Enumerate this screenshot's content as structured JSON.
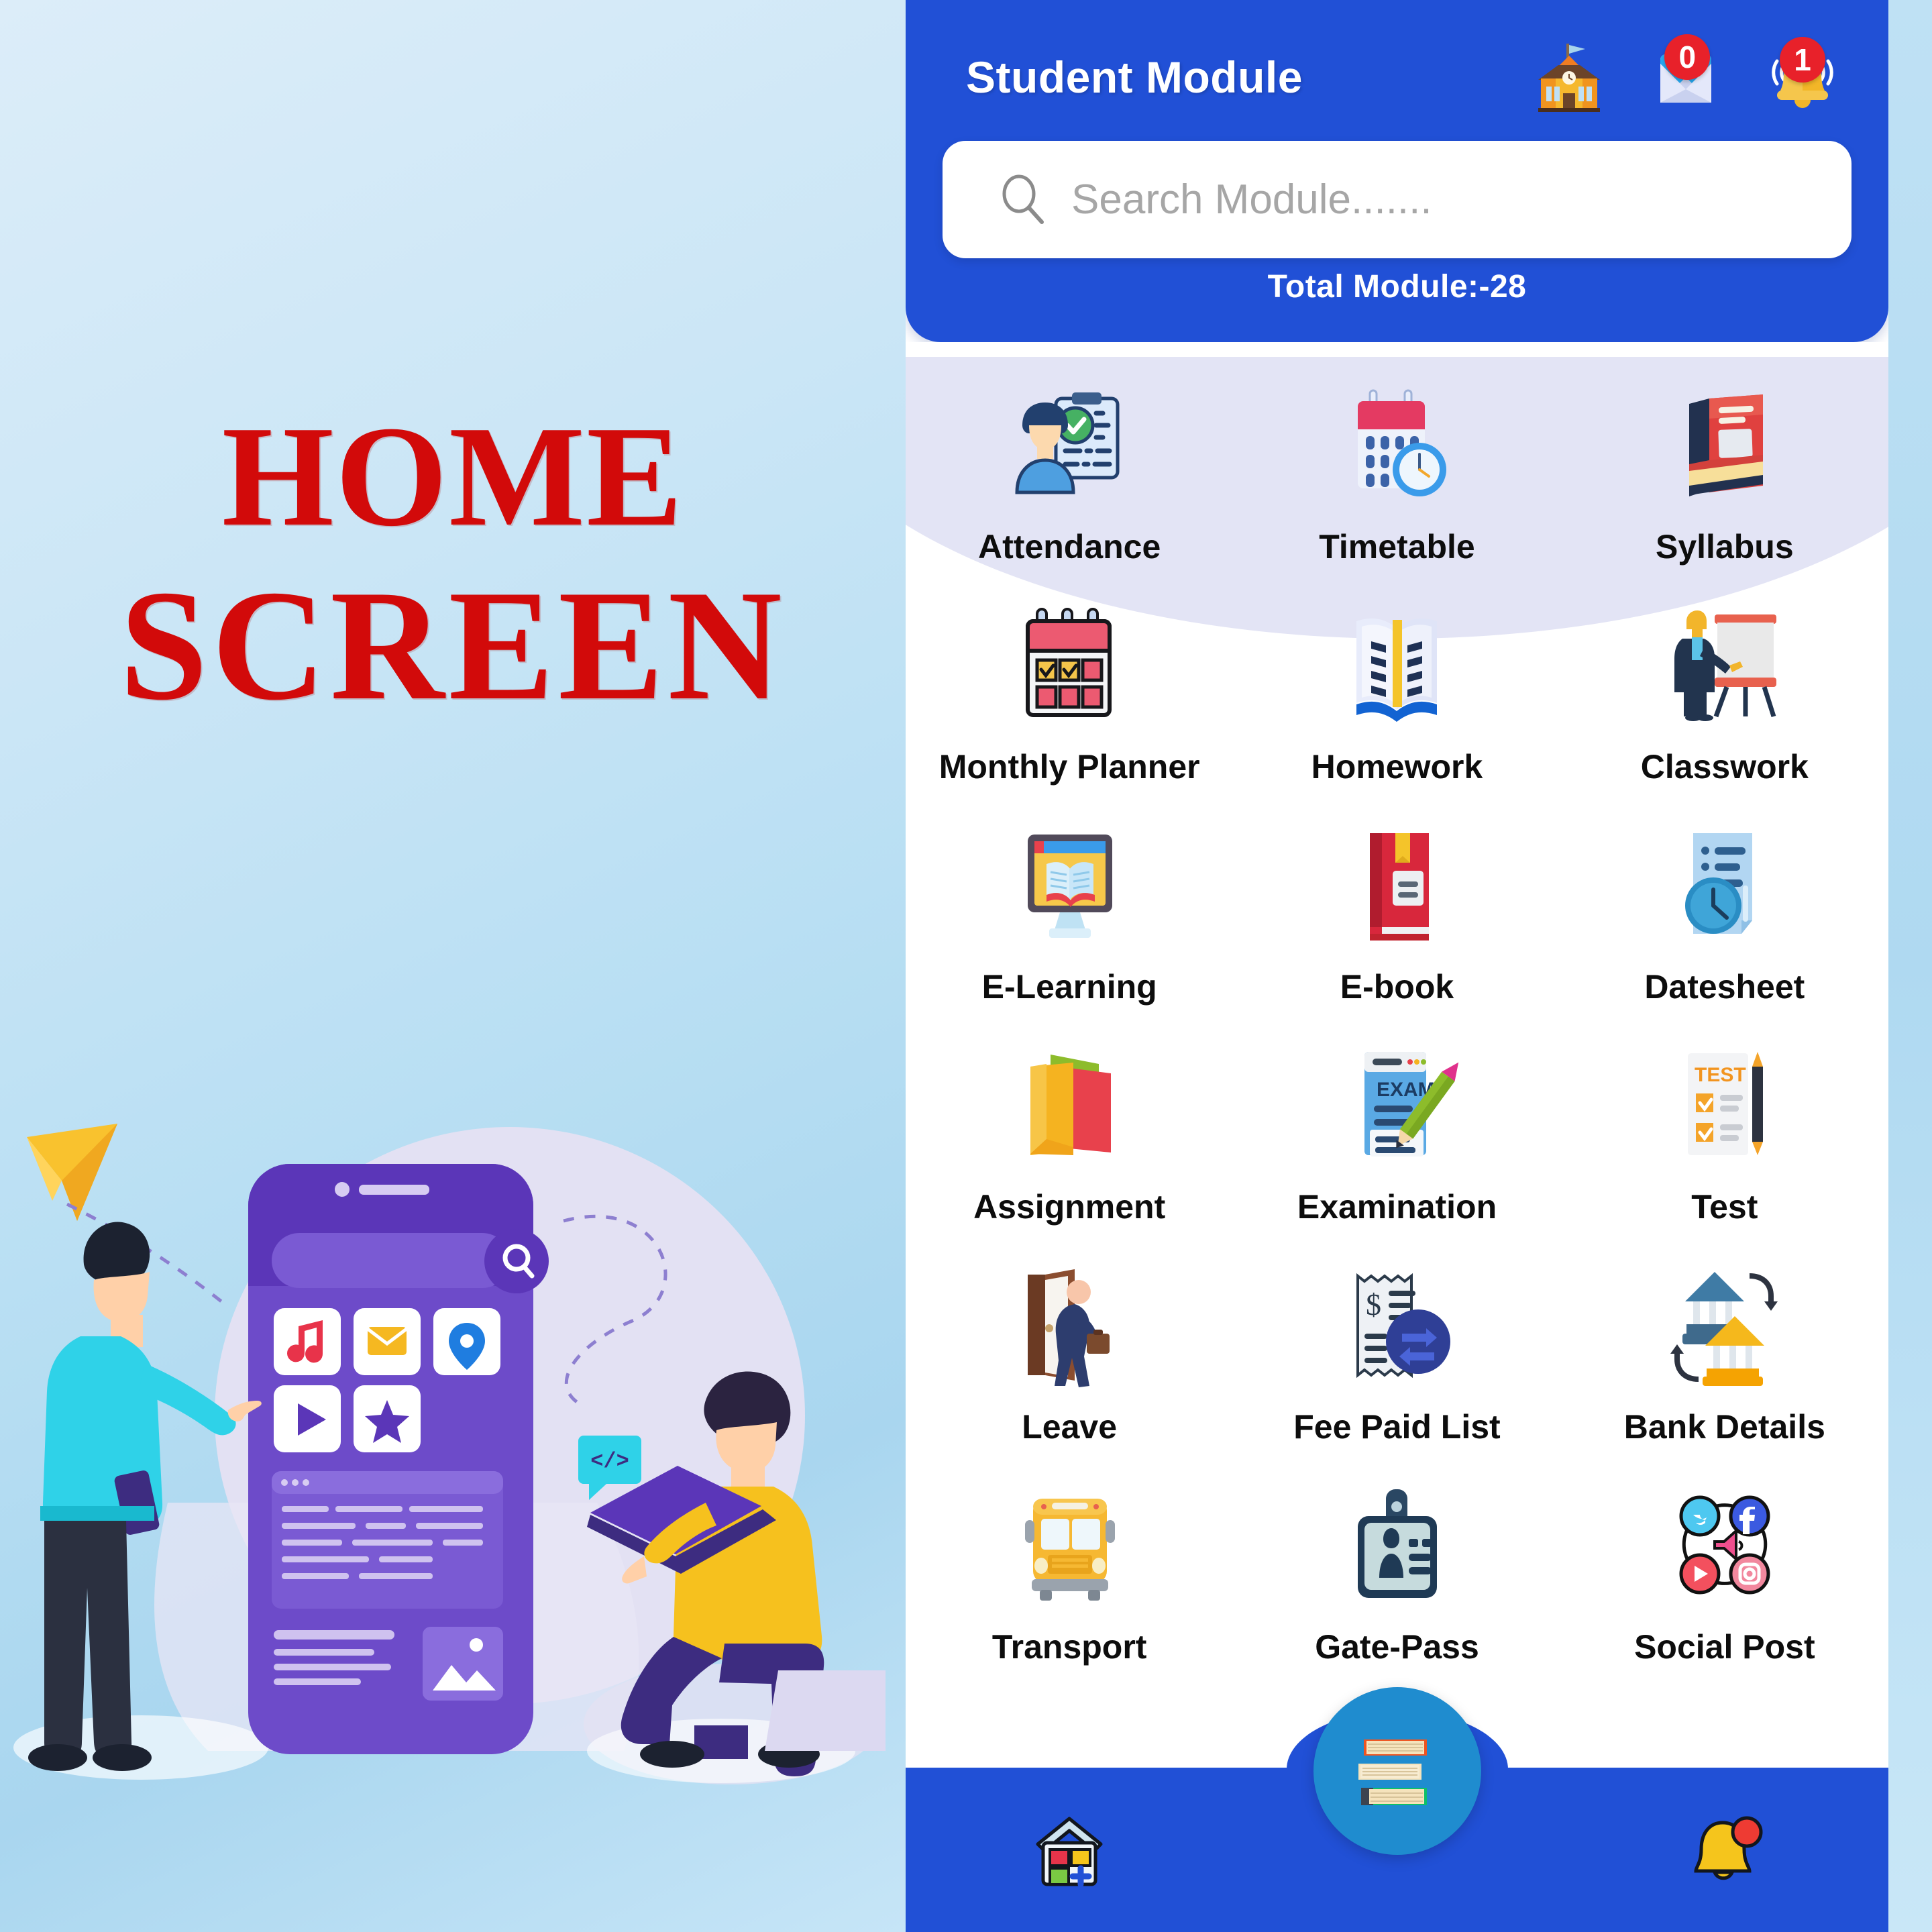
{
  "left_panel": {
    "title_line1": "HOME",
    "title_line2": "SCREEN",
    "illustration_name": "mobile-app-development-illustration"
  },
  "header": {
    "title": "Student Module",
    "school_icon": "school-building-icon",
    "mail_icon": "envelope-icon",
    "mail_badge": "0",
    "bell_icon": "notification-bell-icon",
    "bell_badge": "1"
  },
  "search": {
    "placeholder": "Search Module.......",
    "value": "",
    "icon": "search-icon"
  },
  "total_module_label": "Total Module:-28",
  "modules": [
    {
      "label": "Attendance",
      "icon": "attendance-icon"
    },
    {
      "label": "Timetable",
      "icon": "calendar-clock-icon"
    },
    {
      "label": "Syllabus",
      "icon": "books-icon"
    },
    {
      "label": "Monthly Planner",
      "icon": "planner-calendar-icon"
    },
    {
      "label": "Homework",
      "icon": "open-book-icon"
    },
    {
      "label": "Classwork",
      "icon": "teacher-board-icon"
    },
    {
      "label": "E-Learning",
      "icon": "monitor-book-icon"
    },
    {
      "label": "E-book",
      "icon": "red-book-icon"
    },
    {
      "label": "Datesheet",
      "icon": "document-clock-icon"
    },
    {
      "label": "Assignment",
      "icon": "folders-icon"
    },
    {
      "label": "Examination",
      "icon": "exam-pencil-icon"
    },
    {
      "label": "Test",
      "icon": "test-checklist-icon"
    },
    {
      "label": "Leave",
      "icon": "door-exit-icon"
    },
    {
      "label": "Fee Paid List",
      "icon": "receipt-transfer-icon"
    },
    {
      "label": "Bank Details",
      "icon": "bank-transfer-icon"
    },
    {
      "label": "Transport",
      "icon": "school-bus-icon"
    },
    {
      "label": "Gate-Pass",
      "icon": "id-card-icon"
    },
    {
      "label": "Social Post",
      "icon": "social-media-icon"
    }
  ],
  "bottom_nav": [
    {
      "name": "home",
      "icon": "home-house-icon"
    },
    {
      "name": "modules",
      "icon": "book-stack-icon"
    },
    {
      "name": "notifications",
      "icon": "bell-icon"
    }
  ],
  "colors": {
    "primary_blue": "#2150d6",
    "fab_blue": "#1f8ccf",
    "badge_red": "#e8212a",
    "title_red": "#d20a0a",
    "arc_lavender": "#e3e4f5",
    "page_bg_blue": "#c3e2f4"
  }
}
